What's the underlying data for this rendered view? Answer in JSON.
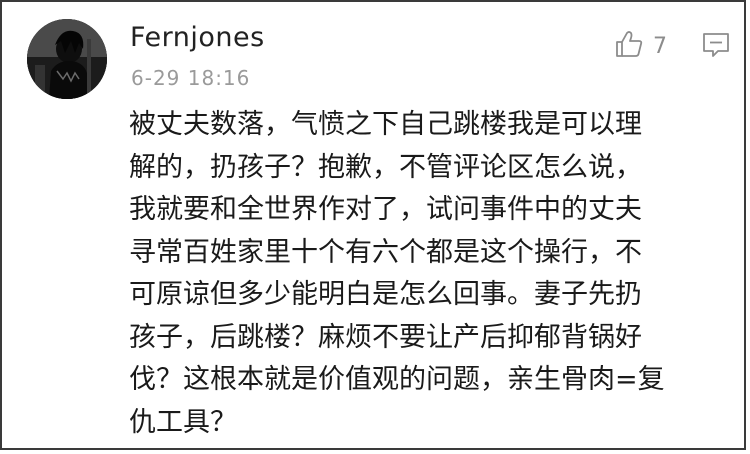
{
  "comment": {
    "username": "Fernjones",
    "timestamp": "6-29 18:16",
    "like_count": "7",
    "icons": {
      "avatar": "avatar-photo",
      "like": "thumbs-up-icon",
      "reply": "comment-bubble-icon"
    },
    "text_lines": [
      "被丈夫数落，气愤之下自己跳楼我是可以理",
      "解的，扔孩子？抱歉，不管评论区怎么说，",
      "我就要和全世界作对了，试问事件中的丈夫",
      "寻常百姓家里十个有六个都是这个操行，不",
      "可原谅但多少能明白是怎么回事。妻子先扔",
      "孩子，后跳楼？麻烦不要让产后抑郁背锅好",
      "伐？这根本就是价值观的问题，亲生骨肉=复",
      "仇工具？"
    ]
  }
}
